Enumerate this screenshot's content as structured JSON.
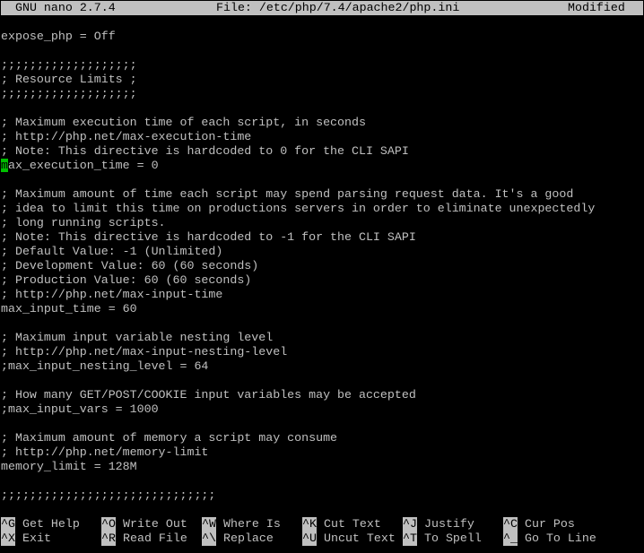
{
  "titlebar": {
    "app": "GNU nano 2.7.4",
    "file": "File: /etc/php/7.4/apache2/php.ini",
    "status": "Modified"
  },
  "editor": {
    "cursor_char": "m",
    "lines": [
      "expose_php = Off",
      "",
      ";;;;;;;;;;;;;;;;;;;",
      "; Resource Limits ;",
      ";;;;;;;;;;;;;;;;;;;",
      "",
      "; Maximum execution time of each script, in seconds",
      "; http://php.net/max-execution-time",
      "; Note: This directive is hardcoded to 0 for the CLI SAPI",
      "max_execution_time = 0",
      "",
      "; Maximum amount of time each script may spend parsing request data. It's a good",
      "; idea to limit this time on productions servers in order to eliminate unexpectedly",
      "; long running scripts.",
      "; Note: This directive is hardcoded to -1 for the CLI SAPI",
      "; Default Value: -1 (Unlimited)",
      "; Development Value: 60 (60 seconds)",
      "; Production Value: 60 (60 seconds)",
      "; http://php.net/max-input-time",
      "max_input_time = 60",
      "",
      "; Maximum input variable nesting level",
      "; http://php.net/max-input-nesting-level",
      ";max_input_nesting_level = 64",
      "",
      "; How many GET/POST/COOKIE input variables may be accepted",
      ";max_input_vars = 1000",
      "",
      "; Maximum amount of memory a script may consume",
      "; http://php.net/memory-limit",
      "memory_limit = 128M",
      "",
      ";;;;;;;;;;;;;;;;;;;;;;;;;;;;;;"
    ],
    "cursor_line": 9
  },
  "shortcuts": {
    "row1": [
      {
        "key": "^G",
        "label": "Get Help"
      },
      {
        "key": "^O",
        "label": "Write Out"
      },
      {
        "key": "^W",
        "label": "Where Is"
      },
      {
        "key": "^K",
        "label": "Cut Text"
      },
      {
        "key": "^J",
        "label": "Justify"
      },
      {
        "key": "^C",
        "label": "Cur Pos"
      }
    ],
    "row2": [
      {
        "key": "^X",
        "label": "Exit"
      },
      {
        "key": "^R",
        "label": "Read File"
      },
      {
        "key": "^\\",
        "label": "Replace"
      },
      {
        "key": "^U",
        "label": "Uncut Text"
      },
      {
        "key": "^T",
        "label": "To Spell"
      },
      {
        "key": "^_",
        "label": "Go To Line"
      }
    ]
  },
  "colors": {
    "background": "#000000",
    "text": "#c0c0c0",
    "inverse_bg": "#c0c0c0",
    "cursor": "#00c000"
  }
}
